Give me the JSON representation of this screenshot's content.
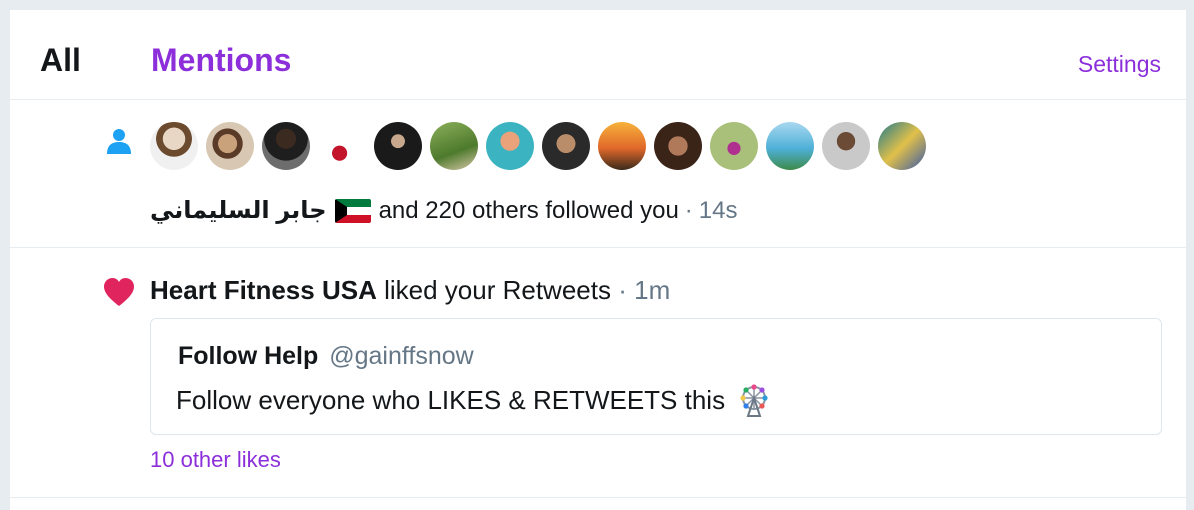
{
  "tabs": {
    "all_label": "All",
    "mentions_label": "Mentions",
    "settings_label": "Settings"
  },
  "colors": {
    "accent": "#8c2fdb",
    "heart": "#e0245e",
    "person_icon": "#1da1f2",
    "muted": "#657786"
  },
  "follow_notification": {
    "icon": "person-icon",
    "avatar_count": 14,
    "name": "جابر السليماني",
    "flag": "kuwait-flag-icon",
    "text": "and 220 others followed you",
    "separator": "·",
    "time": "14s"
  },
  "like_notification": {
    "icon": "heart-icon",
    "who": "Heart Fitness USA",
    "action": "liked your Retweets",
    "separator": "·",
    "time": "1m",
    "tweet": {
      "author": "Follow Help",
      "handle": "@gainffsnow",
      "text": "Follow everyone who LIKES & RETWEETS this",
      "emoji": "ferris-wheel-icon"
    },
    "other_likes_label": "10 other likes"
  }
}
